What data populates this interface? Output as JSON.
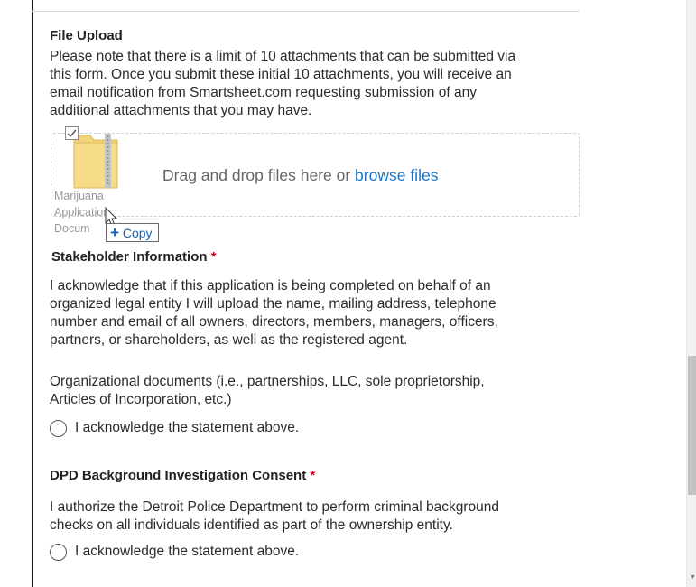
{
  "file_upload": {
    "title": "File Upload",
    "note_lines": [
      "Please note that there is a limit of 10 attachments that can be submitted via",
      "this form. Once you submit these initial 10 attachments, you will receive an",
      "email notification from Smartsheet.com requesting submission of any",
      "additional attachments that you may have."
    ],
    "dropzone_text": "Drag and drop files here or ",
    "browse_link": "browse files",
    "dragged_file": {
      "icon": "zip-folder-icon",
      "label_lines": [
        "Marijuana",
        "Application",
        "Docum"
      ]
    },
    "copy_tooltip": {
      "symbol": "+",
      "label": "Copy"
    }
  },
  "stakeholder": {
    "title": "Stakeholder Information",
    "required_mark": "*",
    "para1_lines": [
      "I acknowledge that if this application is being completed on behalf of an",
      "organized legal entity I will upload the name, mailing address, telephone",
      "number and email of all owners, directors, members, managers, officers,",
      "partners, or shareholders, as well as the registered agent."
    ],
    "para2_lines": [
      "Organizational documents (i.e., partnerships, LLC, sole proprietorship,",
      "Articles of Incorporation, etc.)"
    ],
    "radio_label": "I acknowledge the statement above."
  },
  "dpd": {
    "title": "DPD Background Investigation Consent",
    "required_mark": "*",
    "para_lines": [
      "I authorize the Detroit Police Department to perform criminal background",
      "checks on all individuals identified as part of the ownership entity."
    ],
    "radio_label": "I acknowledge the statement above."
  },
  "colors": {
    "link": "#1a73c8",
    "required": "#d0021b"
  }
}
